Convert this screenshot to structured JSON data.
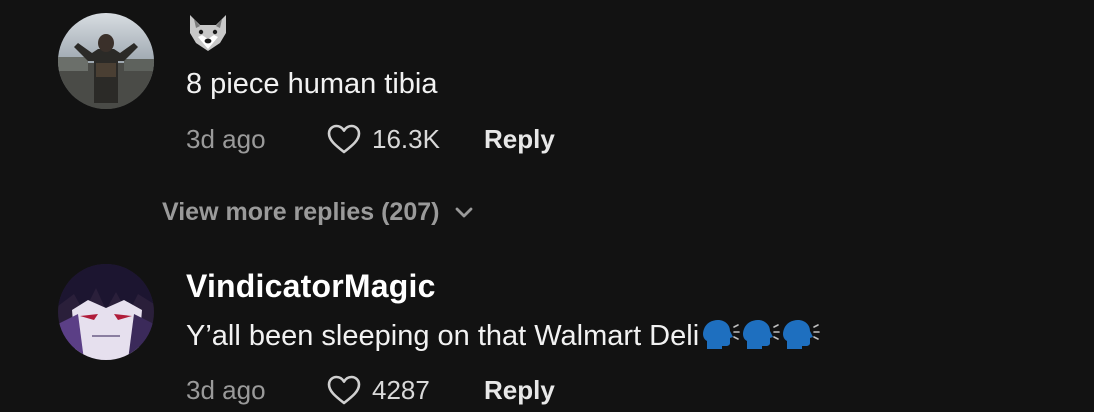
{
  "comments": [
    {
      "author": "",
      "author_emoji": "wolf-face-emoji",
      "text": "8 piece human tibia",
      "emojis": [],
      "time": "3d ago",
      "likes": "16.3K",
      "reply_label": "Reply"
    },
    {
      "author": "VindicatorMagic",
      "text": "Y’all been sleeping on that Walmart Deli",
      "emojis": [
        "speaking-head-emoji",
        "speaking-head-emoji",
        "speaking-head-emoji"
      ],
      "time": "3d ago",
      "likes": "4287",
      "reply_label": "Reply"
    }
  ],
  "view_more": {
    "label": "View more replies (207)",
    "icon": "chevron-down-icon"
  },
  "colors": {
    "background": "#121212",
    "secondary_text": "#9a9a9a",
    "emoji_blue": "#1e6fbf"
  }
}
